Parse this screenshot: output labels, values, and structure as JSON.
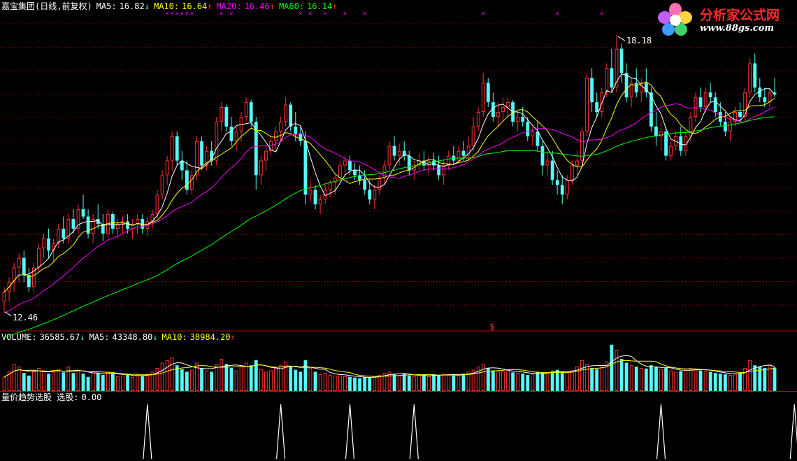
{
  "header": {
    "name": "嘉宝集团",
    "period": "(日线,前复权)",
    "ma5_label": "MA5:",
    "ma5_value": "16.82",
    "ma5_arrow": "↓",
    "ma10_label": "MA10:",
    "ma10_value": "16.64",
    "ma10_arrow": "↑",
    "ma20_label": "MA20:",
    "ma20_value": "16.46",
    "ma20_arrow": "↑",
    "ma60_label": "MA60:",
    "ma60_value": "16.14",
    "ma60_arrow": "↑"
  },
  "volume_header": {
    "label": "VOLUME:",
    "value": "36585.67",
    "arrow": "↓",
    "ma5_label": "MA5:",
    "ma5_value": "43348.80",
    "ma5_arrow": "↓",
    "ma10_label": "MA10:",
    "ma10_value": "38984.20",
    "ma10_arrow": "↑"
  },
  "indicator_header": {
    "label": "量价趋势选股 选股:",
    "value": "0.00"
  },
  "annotations": {
    "high": "18.18",
    "low": "12.46",
    "marker": "$"
  },
  "logo": {
    "title": "分析家公式网",
    "url": "www.88gs.com"
  },
  "colors": {
    "background": "#000000",
    "up": "#ff3232",
    "down": "#54fcfc",
    "ma5": "#ffffff",
    "ma10": "#ffff00",
    "ma20": "#ff00ff",
    "ma60": "#00ff00",
    "grid": "#a00000",
    "divider": "#c00000"
  },
  "chart_data": {
    "type": "candlestick",
    "title": "嘉宝集团(日线,前复权)",
    "price_range": [
      12.2,
      18.7
    ],
    "volume_range": [
      0,
      75000
    ],
    "indicator_range": [
      0,
      1
    ],
    "high_marker": 18.18,
    "low_marker": 12.46,
    "last_ma": {
      "ma5": 16.82,
      "ma10": 16.64,
      "ma20": 16.46,
      "ma60": 16.14
    },
    "last_volume": {
      "volume": 36585.67,
      "ma5": 43348.8,
      "ma10": 38984.2
    },
    "signal_indices": [
      29,
      56,
      70,
      83,
      133,
      160,
      173
    ],
    "x_marker_indices": [
      33,
      34,
      35,
      36,
      37,
      38,
      44,
      46,
      60,
      62,
      65,
      69,
      73,
      97,
      112,
      121,
      137
    ],
    "ohlc": [
      [
        12.7,
        13.0,
        12.46,
        12.9
      ],
      [
        12.9,
        13.2,
        12.7,
        13.1
      ],
      [
        13.1,
        13.5,
        12.9,
        13.4
      ],
      [
        13.4,
        13.7,
        13.1,
        13.6
      ],
      [
        13.6,
        13.75,
        13.1,
        13.25
      ],
      [
        13.25,
        13.4,
        12.9,
        13.0
      ],
      [
        13.0,
        13.5,
        12.9,
        13.4
      ],
      [
        13.4,
        13.9,
        13.3,
        13.8
      ],
      [
        13.8,
        14.1,
        13.6,
        14.0
      ],
      [
        14.0,
        14.2,
        13.6,
        13.75
      ],
      [
        13.75,
        14.0,
        13.5,
        13.9
      ],
      [
        13.9,
        14.3,
        13.8,
        14.2
      ],
      [
        14.2,
        14.45,
        13.9,
        14.0
      ],
      [
        14.0,
        14.5,
        13.9,
        14.4
      ],
      [
        14.4,
        14.6,
        14.1,
        14.2
      ],
      [
        14.2,
        14.7,
        14.1,
        14.6
      ],
      [
        14.6,
        14.9,
        14.4,
        14.45
      ],
      [
        14.45,
        14.6,
        14.0,
        14.1
      ],
      [
        14.1,
        14.5,
        13.9,
        14.4
      ],
      [
        14.4,
        14.7,
        14.2,
        14.3
      ],
      [
        14.3,
        14.5,
        13.95,
        14.1
      ],
      [
        14.1,
        14.6,
        14.0,
        14.5
      ],
      [
        14.5,
        14.55,
        14.1,
        14.2
      ],
      [
        14.2,
        14.4,
        14.0,
        14.3
      ],
      [
        14.3,
        14.45,
        14.1,
        14.35
      ],
      [
        14.35,
        14.5,
        14.1,
        14.2
      ],
      [
        14.2,
        14.4,
        14.0,
        14.3
      ],
      [
        14.3,
        14.5,
        14.1,
        14.4
      ],
      [
        14.4,
        14.5,
        14.1,
        14.2
      ],
      [
        14.2,
        14.45,
        14.05,
        14.35
      ],
      [
        14.35,
        14.6,
        14.2,
        14.5
      ],
      [
        14.5,
        15.0,
        14.4,
        14.9
      ],
      [
        14.9,
        15.4,
        14.8,
        15.3
      ],
      [
        15.3,
        15.7,
        15.1,
        15.6
      ],
      [
        15.6,
        16.2,
        15.4,
        16.1
      ],
      [
        16.1,
        16.2,
        15.5,
        15.6
      ],
      [
        15.6,
        15.8,
        15.2,
        15.4
      ],
      [
        15.4,
        15.6,
        14.9,
        15.0
      ],
      [
        15.0,
        15.4,
        14.9,
        15.3
      ],
      [
        15.3,
        16.1,
        15.2,
        16.0
      ],
      [
        16.0,
        16.1,
        15.4,
        15.5
      ],
      [
        15.5,
        15.9,
        15.4,
        15.8
      ],
      [
        15.8,
        16.0,
        15.5,
        15.6
      ],
      [
        15.6,
        16.5,
        15.5,
        16.4
      ],
      [
        16.4,
        16.8,
        16.2,
        16.7
      ],
      [
        16.7,
        16.75,
        16.2,
        16.3
      ],
      [
        16.3,
        16.5,
        15.9,
        16.0
      ],
      [
        16.0,
        16.3,
        15.8,
        16.2
      ],
      [
        16.2,
        16.6,
        16.0,
        16.5
      ],
      [
        16.5,
        16.9,
        16.4,
        16.8
      ],
      [
        16.8,
        16.85,
        16.3,
        16.4
      ],
      [
        16.4,
        16.5,
        15.0,
        15.3
      ],
      [
        15.3,
        15.7,
        15.1,
        15.6
      ],
      [
        15.6,
        15.9,
        15.4,
        15.8
      ],
      [
        15.8,
        16.1,
        15.7,
        16.0
      ],
      [
        16.0,
        16.3,
        15.8,
        16.2
      ],
      [
        16.2,
        16.5,
        16.0,
        16.4
      ],
      [
        16.4,
        16.9,
        16.3,
        16.75
      ],
      [
        16.75,
        16.8,
        16.2,
        16.3
      ],
      [
        16.3,
        16.6,
        16.0,
        16.15
      ],
      [
        16.15,
        16.3,
        15.9,
        16.0
      ],
      [
        16.0,
        16.2,
        14.7,
        14.9
      ],
      [
        14.9,
        15.2,
        14.75,
        15.0
      ],
      [
        15.0,
        15.1,
        14.6,
        14.7
      ],
      [
        14.7,
        14.9,
        14.5,
        14.8
      ],
      [
        14.8,
        15.1,
        14.7,
        15.0
      ],
      [
        15.0,
        15.2,
        14.85,
        15.15
      ],
      [
        15.15,
        15.3,
        14.9,
        15.25
      ],
      [
        15.25,
        15.6,
        15.2,
        15.5
      ],
      [
        15.5,
        15.7,
        15.3,
        15.6
      ],
      [
        15.6,
        15.7,
        15.3,
        15.4
      ],
      [
        15.4,
        15.55,
        15.2,
        15.3
      ],
      [
        15.3,
        15.5,
        15.1,
        15.2
      ],
      [
        15.2,
        15.4,
        14.9,
        15.0
      ],
      [
        15.0,
        15.2,
        14.7,
        14.8
      ],
      [
        14.8,
        15.1,
        14.6,
        15.0
      ],
      [
        15.0,
        15.3,
        14.9,
        15.25
      ],
      [
        15.25,
        15.6,
        15.1,
        15.5
      ],
      [
        15.5,
        16.0,
        15.4,
        15.9
      ],
      [
        15.9,
        16.1,
        15.6,
        15.7
      ],
      [
        15.7,
        15.95,
        15.5,
        15.8
      ],
      [
        15.8,
        16.0,
        15.6,
        15.7
      ],
      [
        15.7,
        15.8,
        15.3,
        15.4
      ],
      [
        15.4,
        15.6,
        15.2,
        15.5
      ],
      [
        15.5,
        15.75,
        15.4,
        15.6
      ],
      [
        15.6,
        15.8,
        15.4,
        15.5
      ],
      [
        15.5,
        15.7,
        15.3,
        15.6
      ],
      [
        15.6,
        15.75,
        15.4,
        15.5
      ],
      [
        15.5,
        15.7,
        15.2,
        15.3
      ],
      [
        15.3,
        15.6,
        15.1,
        15.5
      ],
      [
        15.5,
        15.8,
        15.4,
        15.7
      ],
      [
        15.7,
        15.9,
        15.5,
        15.6
      ],
      [
        15.6,
        15.9,
        15.55,
        15.8
      ],
      [
        15.8,
        16.0,
        15.6,
        15.7
      ],
      [
        15.7,
        16.1,
        15.6,
        15.9
      ],
      [
        15.9,
        16.5,
        15.8,
        16.3
      ],
      [
        16.3,
        16.7,
        16.2,
        16.6
      ],
      [
        16.6,
        17.4,
        16.5,
        17.2
      ],
      [
        17.2,
        17.3,
        16.7,
        16.8
      ],
      [
        16.8,
        17.0,
        16.4,
        16.5
      ],
      [
        16.5,
        16.8,
        16.3,
        16.6
      ],
      [
        16.6,
        16.9,
        16.4,
        16.7
      ],
      [
        16.7,
        16.9,
        16.5,
        16.8
      ],
      [
        16.8,
        16.85,
        16.3,
        16.4
      ],
      [
        16.4,
        16.6,
        16.2,
        16.5
      ],
      [
        16.5,
        16.7,
        16.3,
        16.4
      ],
      [
        16.4,
        16.5,
        16.0,
        16.1
      ],
      [
        16.1,
        16.3,
        15.9,
        16.2
      ],
      [
        16.2,
        16.4,
        15.8,
        15.9
      ],
      [
        15.9,
        16.0,
        15.3,
        15.5
      ],
      [
        15.5,
        15.8,
        15.3,
        15.6
      ],
      [
        15.6,
        15.8,
        15.1,
        15.2
      ],
      [
        15.2,
        15.4,
        14.9,
        15.1
      ],
      [
        15.1,
        15.3,
        14.7,
        14.9
      ],
      [
        14.9,
        15.3,
        14.8,
        15.2
      ],
      [
        15.2,
        15.6,
        15.1,
        15.5
      ],
      [
        15.5,
        15.8,
        15.3,
        15.6
      ],
      [
        15.6,
        16.3,
        15.5,
        16.2
      ],
      [
        16.2,
        17.4,
        16.1,
        17.3
      ],
      [
        17.3,
        17.5,
        16.6,
        16.8
      ],
      [
        16.8,
        17.0,
        16.5,
        16.6
      ],
      [
        16.6,
        17.1,
        16.5,
        17.0
      ],
      [
        17.0,
        17.6,
        16.9,
        17.5
      ],
      [
        17.5,
        17.9,
        17.0,
        17.1
      ],
      [
        17.1,
        18.18,
        17.0,
        17.9
      ],
      [
        17.9,
        18.0,
        17.2,
        17.4
      ],
      [
        17.4,
        17.6,
        16.8,
        16.9
      ],
      [
        16.9,
        17.3,
        16.7,
        17.2
      ],
      [
        17.2,
        17.5,
        16.9,
        17.0
      ],
      [
        17.0,
        17.3,
        16.8,
        17.2
      ],
      [
        17.2,
        17.5,
        16.9,
        17.0
      ],
      [
        17.0,
        17.1,
        16.2,
        16.3
      ],
      [
        16.3,
        16.6,
        15.9,
        16.1
      ],
      [
        16.1,
        16.4,
        15.8,
        16.2
      ],
      [
        16.2,
        16.3,
        15.6,
        15.7
      ],
      [
        15.7,
        16.0,
        15.6,
        15.9
      ],
      [
        15.9,
        16.2,
        15.8,
        16.1
      ],
      [
        16.1,
        16.3,
        15.7,
        15.8
      ],
      [
        15.8,
        16.2,
        15.7,
        16.1
      ],
      [
        16.1,
        16.6,
        16.0,
        16.5
      ],
      [
        16.5,
        17.0,
        16.4,
        16.9
      ],
      [
        16.9,
        17.1,
        16.6,
        16.7
      ],
      [
        16.7,
        17.1,
        16.6,
        17.0
      ],
      [
        17.0,
        17.2,
        16.8,
        16.9
      ],
      [
        16.9,
        17.0,
        16.5,
        16.6
      ],
      [
        16.6,
        16.8,
        16.3,
        16.4
      ],
      [
        16.4,
        16.6,
        16.1,
        16.2
      ],
      [
        16.2,
        16.5,
        16.0,
        16.4
      ],
      [
        16.4,
        16.7,
        16.3,
        16.6
      ],
      [
        16.6,
        16.8,
        16.4,
        16.5
      ],
      [
        16.5,
        17.1,
        16.4,
        17.0
      ],
      [
        17.0,
        17.7,
        16.9,
        17.6
      ],
      [
        17.6,
        17.8,
        17.0,
        17.1
      ],
      [
        17.1,
        17.3,
        16.8,
        16.9
      ],
      [
        16.9,
        17.1,
        16.7,
        16.8
      ],
      [
        16.8,
        17.1,
        16.7,
        17.0
      ],
      [
        17.0,
        17.3,
        16.9,
        16.96
      ]
    ],
    "volume": [
      22000,
      30000,
      42000,
      38000,
      28000,
      24000,
      30000,
      36000,
      32000,
      27000,
      30000,
      34000,
      29000,
      38000,
      28000,
      33000,
      27000,
      22000,
      31000,
      28000,
      25000,
      30000,
      27000,
      23000,
      24000,
      26000,
      22000,
      25000,
      23000,
      27000,
      30000,
      36000,
      44000,
      48000,
      52000,
      40000,
      34000,
      30000,
      33000,
      44000,
      35000,
      32000,
      30000,
      42000,
      50000,
      42000,
      36000,
      32000,
      38000,
      44000,
      40000,
      48000,
      34000,
      30000,
      32000,
      36000,
      40000,
      46000,
      38000,
      33000,
      30000,
      48000,
      36000,
      30000,
      26000,
      28000,
      25000,
      24000,
      26000,
      23000,
      22000,
      21000,
      20000,
      22000,
      21000,
      23000,
      25000,
      28000,
      30000,
      26000,
      25000,
      27000,
      24000,
      23000,
      25000,
      24000,
      23000,
      26000,
      25000,
      27000,
      26000,
      24000,
      25000,
      27000,
      30000,
      33000,
      38000,
      42000,
      36000,
      32000,
      30000,
      31000,
      33000,
      29000,
      28000,
      27000,
      25000,
      27000,
      30000,
      28000,
      29000,
      31000,
      33000,
      30000,
      29000,
      32000,
      38000,
      48000,
      42000,
      36000,
      34000,
      40000,
      46000,
      72000,
      64000,
      50000,
      44000,
      40000,
      38000,
      36000,
      35000,
      40000,
      38000,
      34000,
      36000,
      32000,
      30000,
      31000,
      33000,
      36000,
      34000,
      32000,
      31000,
      30000,
      28000,
      27000,
      26000,
      25000,
      27000,
      28000,
      36000,
      48000,
      40000,
      38000,
      36000,
      40000,
      36586
    ]
  }
}
